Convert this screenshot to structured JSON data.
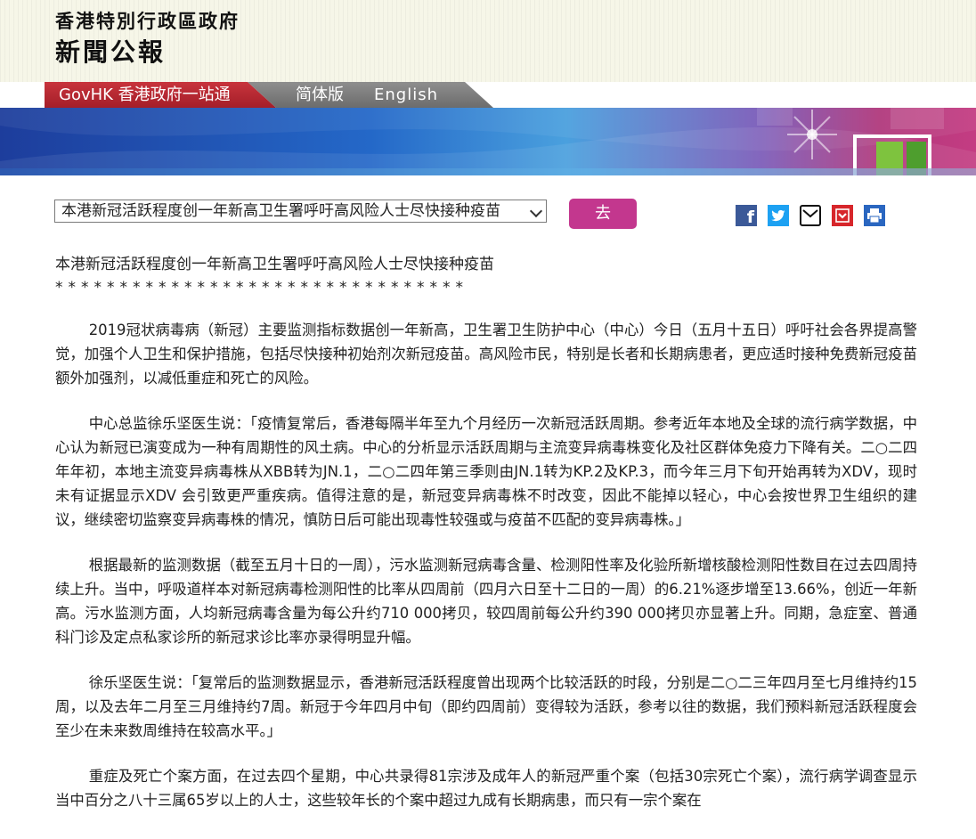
{
  "header": {
    "government": "香港特別行政區政府",
    "title": "新聞公報"
  },
  "nav": {
    "govhk": "GovHK 香港政府一站通",
    "simplified": "简体版",
    "english": "English"
  },
  "controls": {
    "select_value": "本港新冠活跃程度创一年新高卫生署呼吁高风险人士尽快接种疫苗",
    "go_label": "去"
  },
  "share_icons": [
    "facebook-icon",
    "twitter-icon",
    "email-icon",
    "bookmark-icon",
    "print-icon"
  ],
  "colors": {
    "govhk_tab": "#b8272f",
    "lang_tab": "#808080",
    "go_button": "#c3378e"
  },
  "article": {
    "headline": "本港新冠活跃程度创一年新高卫生署呼吁高风险人士尽快接种疫苗",
    "stars": "********************************",
    "paragraphs": [
      "2019冠状病毒病（新冠）主要监测指标数据创一年新高，卫生署卫生防护中心（中心）今日（五月十五日）呼吁社会各界提高警觉，加强个人卫生和保护措施，包括尽快接种初始剂次新冠疫苗。高风险市民，特别是长者和长期病患者，更应适时接种免费新冠疫苗额外加强剂，以减低重症和死亡的风险。",
      "中心总监徐乐坚医生说：「疫情复常后，香港每隔半年至九个月经历一次新冠活跃周期。参考近年本地及全球的流行病学数据，中心认为新冠已演变成为一种有周期性的风土病。中心的分析显示活跃周期与主流变异病毒株变化及社区群体免疫力下降有关。二○二四年年初，本地主流变异病毒株从XBB转为JN.1，二○二四年第三季则由JN.1转为KP.2及KP.3，而今年三月下旬开始再转为XDV，现时未有证据显示XDV 会引致更严重疾病。值得注意的是，新冠变异病毒株不时改变，因此不能掉以轻心，中心会按世界卫生组织的建议，继续密切监察变异病毒株的情况，慎防日后可能出现毒性较强或与疫苗不匹配的变异病毒株。」",
      "根据最新的监测数据（截至五月十日的一周），污水监测新冠病毒含量、检测阳性率及化验所新增核酸检测阳性数目在过去四周持续上升。当中，呼吸道样本对新冠病毒检测阳性的比率从四周前（四月六日至十二日的一周）的6.21%逐步增至13.66%，创近一年新高。污水监测方面，人均新冠病毒含量为每公升约710 000拷贝，较四周前每公升约390 000拷贝亦显著上升。同期，急症室、普通科门诊及定点私家诊所的新冠求诊比率亦录得明显升幅。",
      "徐乐坚医生说：「复常后的监测数据显示，香港新冠活跃程度曾出现两个比较活跃的时段，分别是二○二三年四月至七月维持约15周，以及去年二月至三月维持约7周。新冠于今年四月中旬（即约四周前）变得较为活跃，参考以往的数据，我们预料新冠活跃程度会至少在未来数周维持在较高水平。」",
      "重症及死亡个案方面，在过去四个星期，中心共录得81宗涉及成年人的新冠严重个案（包括30宗死亡个案），流行病学调查显示当中百分之八十三属65岁以上的人士，这些较年长的个案中超过九成有长期病患，而只有一宗个案在"
    ]
  }
}
